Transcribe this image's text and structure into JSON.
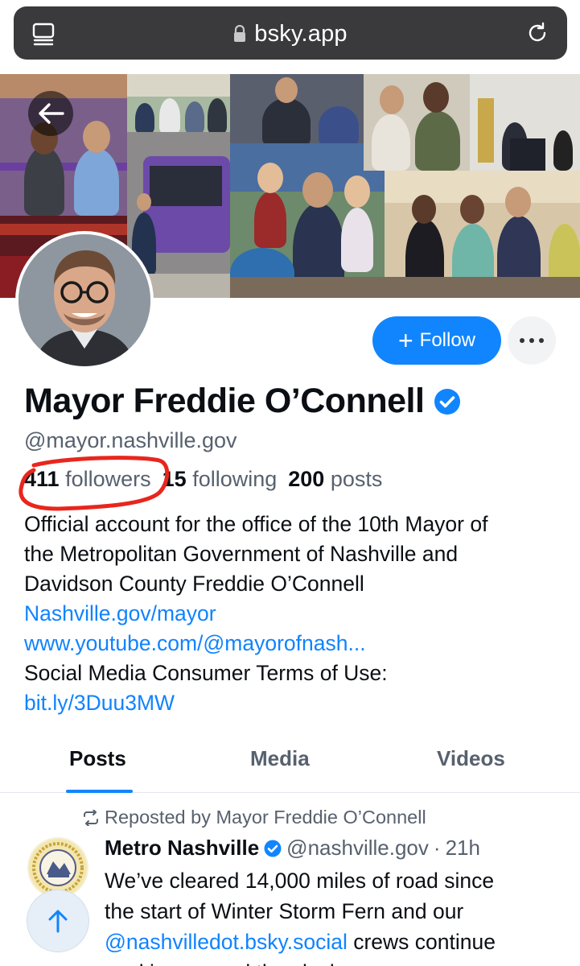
{
  "browser": {
    "url": "bsky.app",
    "icons": {
      "tabs": "tabs-icon",
      "lock": "lock-icon",
      "reload": "reload-icon"
    }
  },
  "profile": {
    "display_name": "Mayor Freddie O’Connell",
    "handle": "@mayor.nashville.gov",
    "followers_count": "411",
    "followers_label": "followers",
    "following_count": "15",
    "following_label": "following",
    "posts_count": "200",
    "posts_label": "posts",
    "bio_line1": "Official account for the office of the 10th Mayor of",
    "bio_line2": "the Metropolitan Government of Nashville and",
    "bio_line3": "Davidson County Freddie O’Connell",
    "link1": "Nashville.gov/mayor",
    "link2": "www.youtube.com/@mayorofnash...",
    "terms_text": "Social Media Consumer Terms of Use:",
    "link3": "bit.ly/3Duu3MW",
    "follow_label": "Follow"
  },
  "tabs": [
    {
      "label": "Posts",
      "active": true
    },
    {
      "label": "Media",
      "active": false
    },
    {
      "label": "Videos",
      "active": false
    }
  ],
  "post": {
    "repost_label": "Reposted by Mayor Freddie O’Connell",
    "author_name": "Metro Nashville",
    "author_handle": "@nashville.gov",
    "separator": "·",
    "time": "21h",
    "text_line1": "We’ve cleared 14,000 miles of road since",
    "text_line2": "the start of Winter Storm Fern and our",
    "text_mention": "@nashvilledot.bsky.social",
    "text_line3_rest": " crews continue",
    "text_line4": "working around the clock"
  },
  "colors": {
    "accent": "#1185fe",
    "link": "#1083fe",
    "annotation": "#e8261d",
    "muted_text": "#57616e"
  }
}
